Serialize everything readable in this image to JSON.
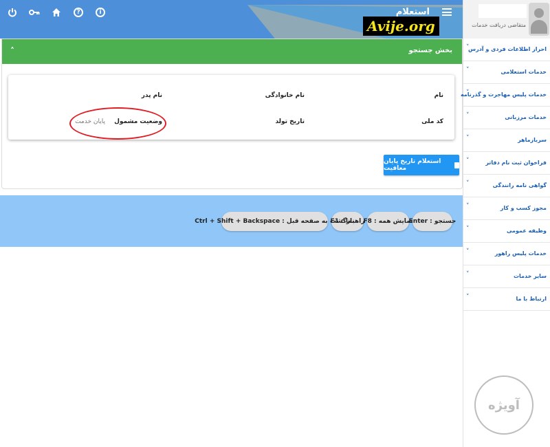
{
  "header": {
    "title": "استعلام",
    "icons": [
      "info-icon",
      "help-icon",
      "home-icon",
      "key-icon",
      "power-icon"
    ]
  },
  "search": {
    "header_title": "بخش جستجو",
    "fields": {
      "name_label": "نام",
      "family_label": "نام خانوادگی",
      "father_label": "نام پدر",
      "national_code_label": "کد ملی",
      "birth_date_label": "تاریخ تولد",
      "status_label": "وضعیت مشمول",
      "status_value": "پایان خدمت"
    },
    "inquiry_button": "استعلام تاریخ پایان معافیت"
  },
  "shortcuts": [
    "Enter : جستجو",
    "F8 : نمایش همه",
    "F1 : راهنما",
    "Ctrl + Shift + Backspace : بازگشت به صفحه قبل"
  ],
  "sidebar": {
    "user_role": "متقاضی دریافت خدمات",
    "items": [
      "احراز اطلاعات فردی و آدرس",
      "خدمات استعلامی",
      "خدمات پلیس مهاجرت و گذرنامه",
      "خدمات مرزبانی",
      "سربازماهر",
      "فراخوان ثبت نام دفاتر",
      "گواهی نامه رانندگی",
      "مجوز کسب و کار",
      "وظیفه عمومی",
      "خدمات پلیس راهور",
      "سایر خدمات",
      "ارتباط با ما"
    ]
  },
  "watermark": {
    "site": "Avije.org",
    "logo_text": "آویژه"
  },
  "colors": {
    "topbar": "#4d8fd8",
    "search_header": "#4caf50",
    "button": "#2196f3",
    "shortcut_band": "#90c6f8",
    "highlight": "#e11b22",
    "sidebar_text": "#1a5fb4"
  }
}
